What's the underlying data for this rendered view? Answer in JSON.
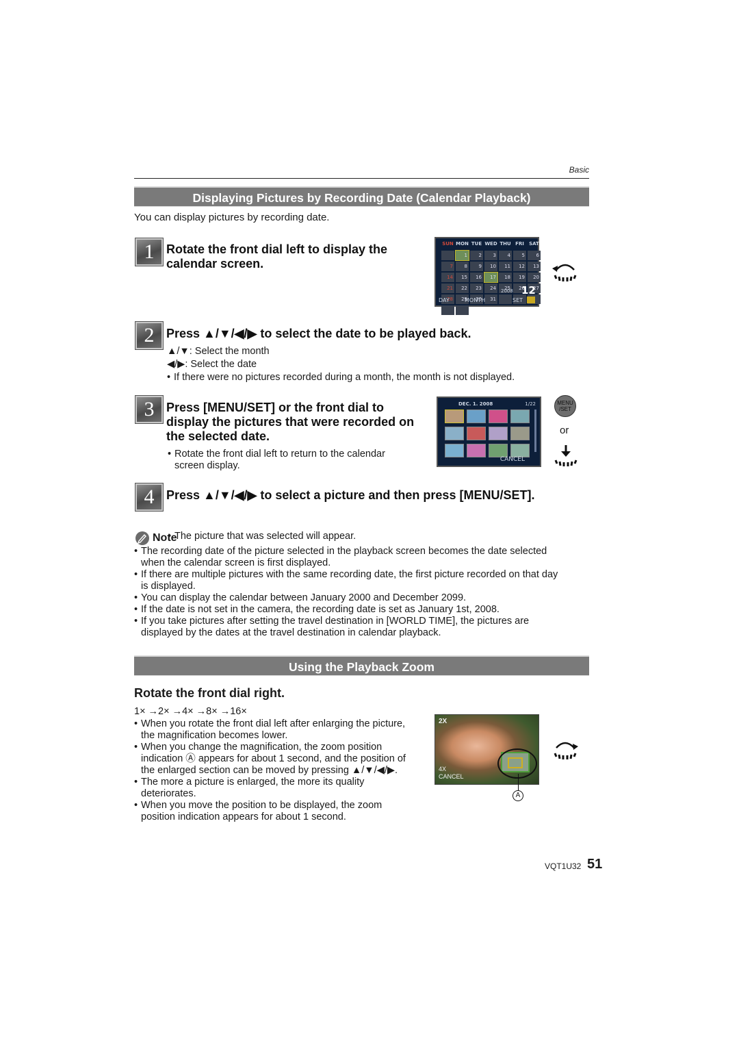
{
  "header": {
    "section_label": "Basic"
  },
  "calendar_section": {
    "banner": "Displaying Pictures by Recording Date (Calendar Playback)",
    "intro": "You can display pictures by recording date.",
    "steps": [
      {
        "number": "1",
        "title_line1": "Rotate the front dial left to display the",
        "title_line2": "calendar screen."
      },
      {
        "number": "2",
        "title": "Press ▲/▼/◀/▶ to select the date to be played back.",
        "lines": [
          {
            "keys": "▲/▼:",
            "text": "Select the month"
          },
          {
            "keys": "◀/▶:",
            "text": "Select the date"
          }
        ],
        "bullet": "If there were no pictures recorded during a month, the month is not displayed."
      },
      {
        "number": "3",
        "title_line1": "Press [MENU/SET] or the front dial to",
        "title_line2": "display the pictures that were recorded on",
        "title_line3": "the selected date.",
        "bullet_line1": "Rotate the front dial left to return to the calendar",
        "bullet_line2": "screen display.",
        "or_label": "or",
        "menu_button_line1": "MENU",
        "menu_button_line2": "/SET"
      },
      {
        "number": "4",
        "title": "Press ▲/▼/◀/▶ to select a picture and then press [MENU/SET].",
        "bullet": "The picture that was selected will appear."
      }
    ],
    "calendar_screen": {
      "weekdays": [
        "SUN",
        "MON",
        "TUE",
        "WED",
        "THU",
        "FRI",
        "SAT"
      ],
      "days": [
        "",
        "1",
        "2",
        "3",
        "4",
        "5",
        "6",
        "7",
        "8",
        "9",
        "10",
        "11",
        "12",
        "13",
        "14",
        "15",
        "16",
        "17",
        "18",
        "19",
        "20",
        "21",
        "22",
        "23",
        "24",
        "25",
        "26",
        "27",
        "28",
        "29",
        "30",
        "31",
        "",
        "",
        "",
        "",
        ""
      ],
      "year": "2008",
      "month": "12",
      "day_label": "DAY",
      "month_label": "MONTH",
      "set_label": "SET"
    },
    "thumbnail_screen": {
      "date": "DEC. 1. 2008",
      "count": "1/22",
      "cancel_label": "CANCEL"
    }
  },
  "note": {
    "title": "Note",
    "items": [
      {
        "line1": "The recording date of the picture selected in the playback screen becomes the date selected",
        "line2": "when the calendar screen is first displayed."
      },
      {
        "line1": "If there are multiple pictures with the same recording date, the first picture recorded on that day",
        "line2": "is displayed."
      },
      {
        "line1": "You can display the calendar between January 2000 and December 2099."
      },
      {
        "line1": "If the date is not set in the camera, the recording date is set as January 1st, 2008."
      },
      {
        "line1": "If you take pictures after setting the travel destination in [WORLD TIME], the pictures are",
        "line2": "displayed by the dates at the travel destination in calendar playback."
      }
    ]
  },
  "zoom_section": {
    "banner": "Using the Playback Zoom",
    "heading": "Rotate the front dial right.",
    "sequence": "1× →2× →4× →8× →16×",
    "items": [
      {
        "line1": "When you rotate the front dial left after enlarging the picture,",
        "line2": "the magnification becomes lower."
      },
      {
        "line1": "When you change the magnification, the zoom position",
        "line2": "indication Ⓐ appears for about 1 second, and the position of",
        "line3": "the enlarged section can be moved by pressing ▲/▼/◀/▶."
      },
      {
        "line1": "The more a picture is enlarged, the more its quality",
        "line2": "deteriorates."
      },
      {
        "line1": "When you move the position to be displayed, the zoom",
        "line2": "position indication appears for about 1 second."
      }
    ],
    "zoom_screen": {
      "zoom_label": "2X",
      "next_zoom": "4X",
      "cancel_label": "CANCEL"
    },
    "callout_label": "A"
  },
  "footer": {
    "model_code": "VQT1U32",
    "page_number": "51"
  }
}
